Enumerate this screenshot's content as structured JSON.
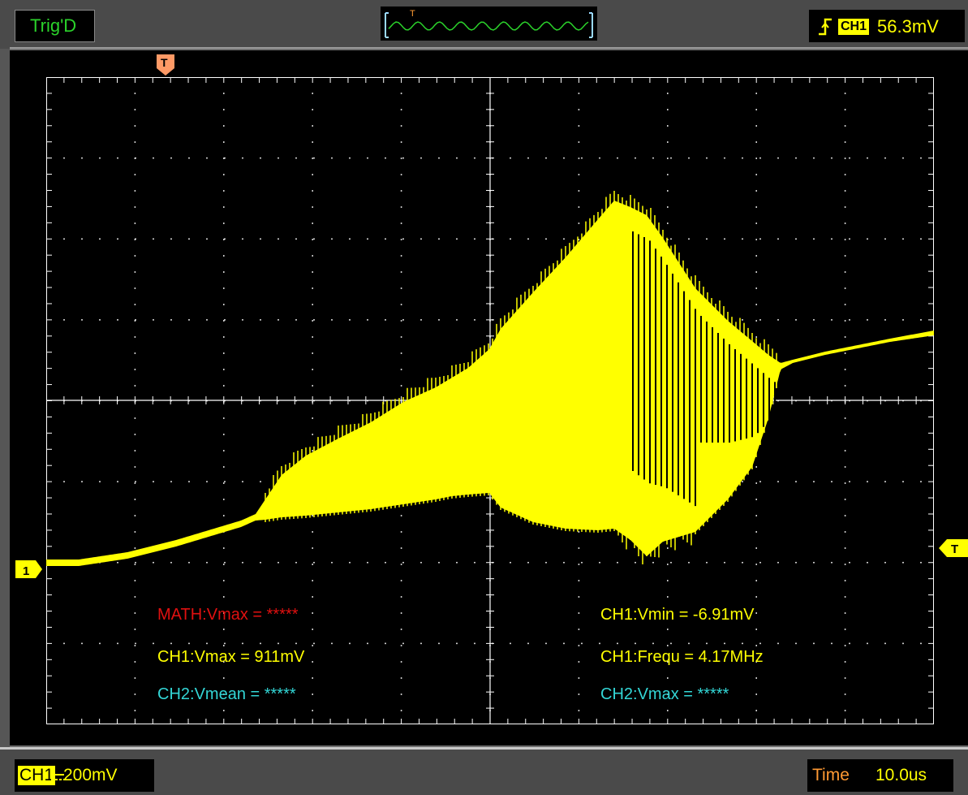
{
  "colors": {
    "ch1": "#ffff00",
    "ch2": "#33d6d6",
    "math": "#e01010",
    "trigger_marker": "#ff9a66",
    "trig_status": "#2bd22b",
    "time_label": "#ff9a33"
  },
  "header": {
    "trig_status": "Trig'D",
    "trigger_position_marker": "T",
    "trigger_edge_icon": "rising-edge-icon",
    "trigger_source": "CH1",
    "trigger_level": "56.3mV"
  },
  "scope": {
    "trigger_marker_top": "T",
    "ch1_ground_marker": "1",
    "trigger_level_marker": "T"
  },
  "measurements": {
    "math_vmax": "MATH:Vmax = *****",
    "ch1_vmax": "CH1:Vmax = 911mV",
    "ch2_vmean": "CH2:Vmean = *****",
    "ch1_vmin": "CH1:Vmin = -6.91mV",
    "ch1_frequ": "CH1:Frequ = 4.17MHz",
    "ch2_vmax": "CH2:Vmax = *****"
  },
  "footer": {
    "ch1_label": "CH1",
    "ch1_scale": "200mV",
    "time_label": "Time",
    "time_scale": "10.0us"
  }
}
